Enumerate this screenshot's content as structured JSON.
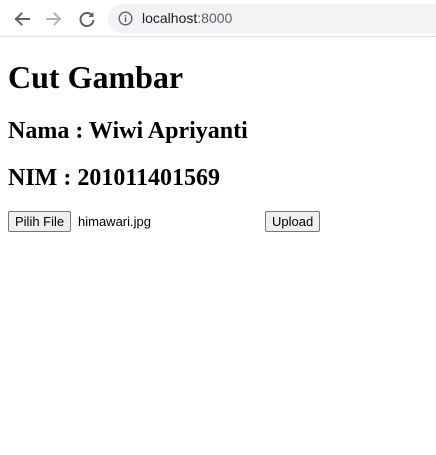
{
  "browser": {
    "url_host": "localhost",
    "url_port": ":8000",
    "icons": [
      "back-arrow-icon",
      "forward-arrow-icon",
      "reload-icon",
      "info-icon"
    ]
  },
  "page": {
    "title": "Cut Gambar",
    "nama": "Nama : Wiwi Apriyanti",
    "nim": "NIM : 201011401569"
  },
  "form": {
    "choose_file_label": "Pilih File",
    "file_name": "himawari.jpg",
    "upload_label": "Upload"
  }
}
